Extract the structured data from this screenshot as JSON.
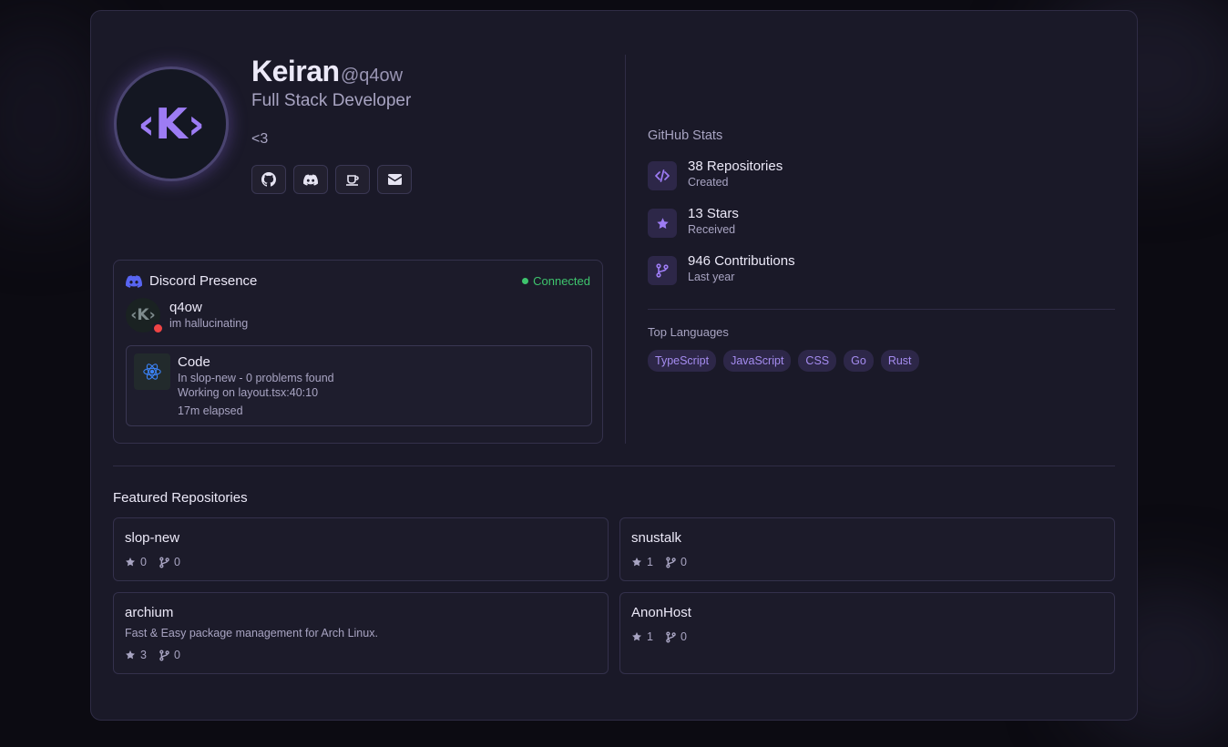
{
  "profile": {
    "avatar_text": "‹K›",
    "name": "Keiran",
    "handle": "@q4ow",
    "title": "Full Stack Developer",
    "bio": "<3",
    "socials": [
      {
        "icon": "github-icon"
      },
      {
        "icon": "discord-icon"
      },
      {
        "icon": "coffee-icon"
      },
      {
        "icon": "mail-icon"
      }
    ]
  },
  "discord": {
    "title": "Discord Presence",
    "status_label": "Connected",
    "avatar_text": "‹K›",
    "username": "q4ow",
    "custom_status": "im hallucinating",
    "activity": {
      "name": "Code",
      "details": "In slop-new - 0 problems found",
      "state": "Working on layout.tsx:40:10",
      "elapsed": "17m elapsed"
    }
  },
  "github": {
    "title": "GitHub Stats",
    "stats": [
      {
        "main": "38 Repositories",
        "sub": "Created",
        "icon": "code-icon"
      },
      {
        "main": "13 Stars",
        "sub": "Received",
        "icon": "star-icon"
      },
      {
        "main": "946 Contributions",
        "sub": "Last year",
        "icon": "git-branch-icon"
      }
    ],
    "languages_title": "Top Languages",
    "languages": [
      "TypeScript",
      "JavaScript",
      "CSS",
      "Go",
      "Rust"
    ]
  },
  "featured": {
    "title": "Featured Repositories",
    "repos": [
      {
        "name": "slop-new",
        "description": "",
        "stars": "0",
        "forks": "0"
      },
      {
        "name": "snustalk",
        "description": "",
        "stars": "1",
        "forks": "0"
      },
      {
        "name": "archium",
        "description": "Fast & Easy package management for Arch Linux.",
        "stars": "3",
        "forks": "0"
      },
      {
        "name": "AnonHost",
        "description": "",
        "stars": "1",
        "forks": "0"
      }
    ]
  },
  "colors": {
    "accent": "#9d7cf4",
    "connected": "#3ec46d",
    "dnd": "#ef4444",
    "background": "#1a1928"
  }
}
